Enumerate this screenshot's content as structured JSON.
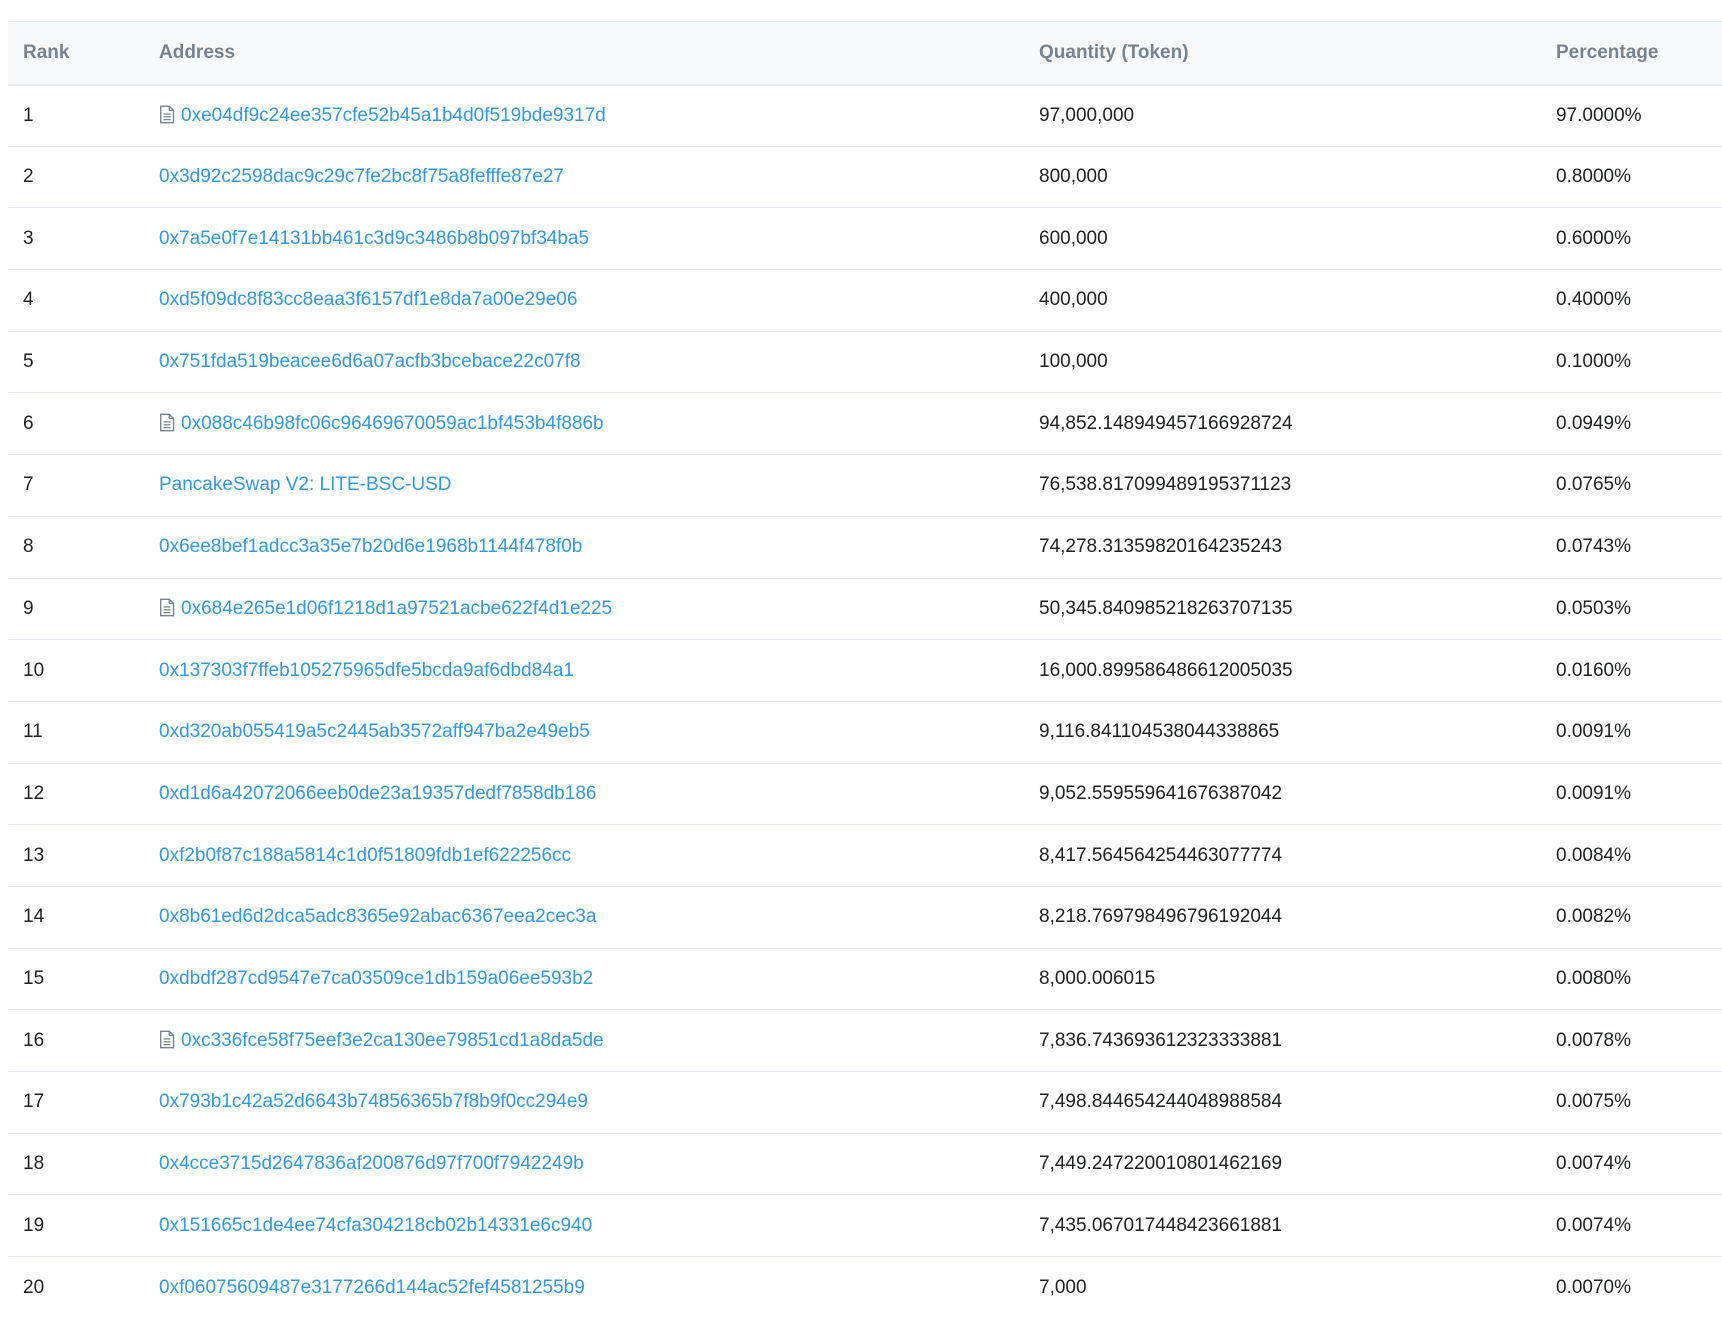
{
  "table": {
    "headers": {
      "rank": "Rank",
      "address": "Address",
      "quantity": "Quantity (Token)",
      "percentage": "Percentage"
    },
    "rows": [
      {
        "rank": "1",
        "address": "0xe04df9c24ee357cfe52b45a1b4d0f519bde9317d",
        "is_contract": true,
        "quantity": "97,000,000",
        "percentage": "97.0000%"
      },
      {
        "rank": "2",
        "address": "0x3d92c2598dac9c29c7fe2bc8f75a8fefffe87e27",
        "is_contract": false,
        "quantity": "800,000",
        "percentage": "0.8000%"
      },
      {
        "rank": "3",
        "address": "0x7a5e0f7e14131bb461c3d9c3486b8b097bf34ba5",
        "is_contract": false,
        "quantity": "600,000",
        "percentage": "0.6000%"
      },
      {
        "rank": "4",
        "address": "0xd5f09dc8f83cc8eaa3f6157df1e8da7a00e29e06",
        "is_contract": false,
        "quantity": "400,000",
        "percentage": "0.4000%"
      },
      {
        "rank": "5",
        "address": "0x751fda519beacee6d6a07acfb3bcebace22c07f8",
        "is_contract": false,
        "quantity": "100,000",
        "percentage": "0.1000%"
      },
      {
        "rank": "6",
        "address": "0x088c46b98fc06c96469670059ac1bf453b4f886b",
        "is_contract": true,
        "quantity": "94,852.148949457166928724",
        "percentage": "0.0949%"
      },
      {
        "rank": "7",
        "address": "PancakeSwap V2: LITE-BSC-USD",
        "is_contract": false,
        "quantity": "76,538.817099489195371123",
        "percentage": "0.0765%"
      },
      {
        "rank": "8",
        "address": "0x6ee8bef1adcc3a35e7b20d6e1968b1144f478f0b",
        "is_contract": false,
        "quantity": "74,278.31359820164235243",
        "percentage": "0.0743%"
      },
      {
        "rank": "9",
        "address": "0x684e265e1d06f1218d1a97521acbe622f4d1e225",
        "is_contract": true,
        "quantity": "50,345.840985218263707135",
        "percentage": "0.0503%"
      },
      {
        "rank": "10",
        "address": "0x137303f7ffeb105275965dfe5bcda9af6dbd84a1",
        "is_contract": false,
        "quantity": "16,000.899586486612005035",
        "percentage": "0.0160%"
      },
      {
        "rank": "11",
        "address": "0xd320ab055419a5c2445ab3572aff947ba2e49eb5",
        "is_contract": false,
        "quantity": "9,116.841104538044338865",
        "percentage": "0.0091%"
      },
      {
        "rank": "12",
        "address": "0xd1d6a42072066eeb0de23a19357dedf7858db186",
        "is_contract": false,
        "quantity": "9,052.559559641676387042",
        "percentage": "0.0091%"
      },
      {
        "rank": "13",
        "address": "0xf2b0f87c188a5814c1d0f51809fdb1ef622256cc",
        "is_contract": false,
        "quantity": "8,417.564564254463077774",
        "percentage": "0.0084%"
      },
      {
        "rank": "14",
        "address": "0x8b61ed6d2dca5adc8365e92abac6367eea2cec3a",
        "is_contract": false,
        "quantity": "8,218.769798496796192044",
        "percentage": "0.0082%"
      },
      {
        "rank": "15",
        "address": "0xdbdf287cd9547e7ca03509ce1db159a06ee593b2",
        "is_contract": false,
        "quantity": "8,000.006015",
        "percentage": "0.0080%"
      },
      {
        "rank": "16",
        "address": "0xc336fce58f75eef3e2ca130ee79851cd1a8da5de",
        "is_contract": true,
        "quantity": "7,836.743693612323333881",
        "percentage": "0.0078%"
      },
      {
        "rank": "17",
        "address": "0x793b1c42a52d6643b74856365b7f8b9f0cc294e9",
        "is_contract": false,
        "quantity": "7,498.844654244048988584",
        "percentage": "0.0075%"
      },
      {
        "rank": "18",
        "address": "0x4cce3715d2647836af200876d97f700f7942249b",
        "is_contract": false,
        "quantity": "7,449.247220010801462169",
        "percentage": "0.0074%"
      },
      {
        "rank": "19",
        "address": "0x151665c1de4ee74cfa304218cb02b14331e6c940",
        "is_contract": false,
        "quantity": "7,435.067017448423661881",
        "percentage": "0.0074%"
      },
      {
        "rank": "20",
        "address": "0xf06075609487e3177266d144ac52fef4581255b9",
        "is_contract": false,
        "quantity": "7,000",
        "percentage": "0.0070%"
      }
    ],
    "contract_icon": "file-text-icon",
    "link_color": "#3498db"
  }
}
